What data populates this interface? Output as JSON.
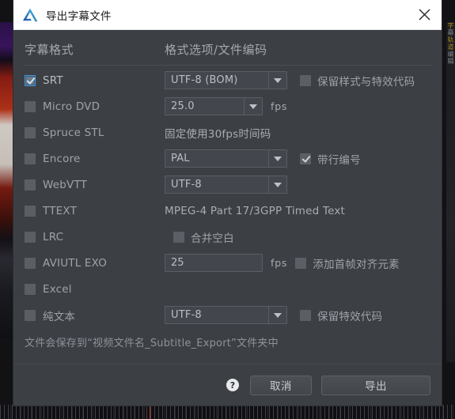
{
  "window": {
    "title": "导出字幕文件",
    "logo_icon": "arctime-logo-icon",
    "close_icon": "close-icon"
  },
  "columns": {
    "format_header": "字幕格式",
    "options_header": "格式选项/文件编码"
  },
  "rows": [
    {
      "name": "srt",
      "label": "SRT",
      "checked": true,
      "control": {
        "kind": "combo",
        "value": "UTF-8 (BOM)"
      },
      "extra": {
        "kind": "checkbox",
        "label": "保留样式与特效代码",
        "checked": false
      }
    },
    {
      "name": "micro-dvd",
      "label": "Micro DVD",
      "checked": false,
      "control": {
        "kind": "combo",
        "value": "25.0",
        "width": 124
      },
      "extra": {
        "kind": "unit",
        "label": "fps"
      }
    },
    {
      "name": "spruce-stl",
      "label": "Spruce STL",
      "checked": false,
      "control": {
        "kind": "note",
        "value": "固定使用30fps时间码"
      }
    },
    {
      "name": "encore",
      "label": "Encore",
      "checked": false,
      "control": {
        "kind": "combo",
        "value": "PAL"
      },
      "extra": {
        "kind": "checkbox",
        "label": "带行编号",
        "checked": true
      }
    },
    {
      "name": "webvtt",
      "label": "WebVTT",
      "checked": false,
      "control": {
        "kind": "combo",
        "value": "UTF-8"
      }
    },
    {
      "name": "ttext",
      "label": "TTEXT",
      "checked": false,
      "control": {
        "kind": "note",
        "value": "MPEG-4 Part 17/3GPP Timed Text"
      }
    },
    {
      "name": "lrc",
      "label": "LRC",
      "checked": false,
      "control": {
        "kind": "checkbox-only",
        "label": "合并空白",
        "checked": false
      }
    },
    {
      "name": "aviutl-exo",
      "label": "AVIUTL EXO",
      "checked": false,
      "control": {
        "kind": "input",
        "value": "25"
      },
      "extra": {
        "kind": "unit-checkbox",
        "unit": "fps",
        "label": "添加首帧对齐元素",
        "checked": false
      }
    },
    {
      "name": "excel",
      "label": "Excel",
      "checked": false,
      "control": {
        "kind": "none"
      }
    },
    {
      "name": "plain-text",
      "label": "纯文本",
      "checked": false,
      "control": {
        "kind": "combo",
        "value": "UTF-8"
      },
      "extra": {
        "kind": "checkbox",
        "label": "保留特效代码",
        "checked": false
      }
    }
  ],
  "footer_note": "文件会保存到“视频文件名_Subtitle_Export”文件夹中",
  "buttons": {
    "help_icon": "help-icon",
    "help_glyph": "?",
    "cancel": "取消",
    "export": "导出"
  }
}
